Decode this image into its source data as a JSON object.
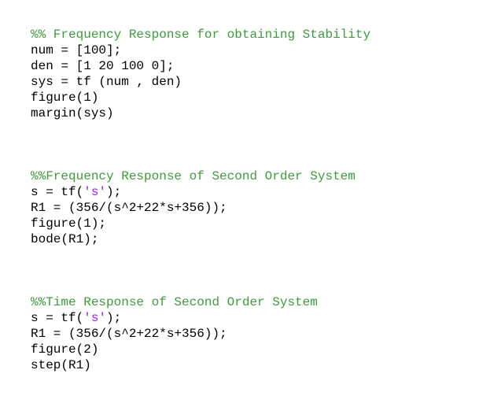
{
  "colors": {
    "comment": "#3c9c3c",
    "string": "#a020f0",
    "code": "#000000",
    "background": "#ffffff"
  },
  "blocks": [
    {
      "comment": "%% Frequency Response for obtaining Stability",
      "lines": [
        "num = [100];",
        "den = [1 20 100 0];",
        "sys = tf (num , den)",
        "figure(1)",
        "margin(sys)"
      ]
    },
    {
      "comment": "%%Frequency Response of Second Order System",
      "lines": [
        {
          "pre": "s = tf(",
          "str": "'s'",
          "post": ");"
        },
        "R1 = (356/(s^2+22*s+356));",
        "figure(1);",
        "bode(R1);"
      ]
    },
    {
      "comment": "%%Time Response of Second Order System",
      "lines": [
        {
          "pre": "s = tf(",
          "str": "'s'",
          "post": ");"
        },
        "R1 = (356/(s^2+22*s+356));",
        "figure(2)",
        "step(R1)"
      ]
    }
  ]
}
